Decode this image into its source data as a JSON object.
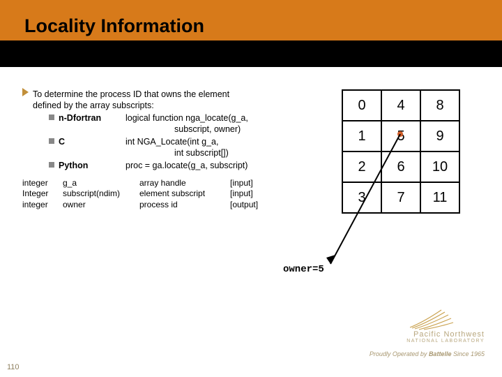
{
  "title": "Locality Information",
  "bullet_main_a": "To determine the process ID that owns the element",
  "bullet_main_b": "defined by the array subscripts:",
  "langs": {
    "fortran": {
      "name": "n-Dfortran",
      "sig_a": "logical function nga_locate(g_a,",
      "sig_b": "subscript, owner)"
    },
    "c": {
      "name": "C",
      "sig_a": "int NGA_Locate(int g_a,",
      "sig_b": "int subscript[])"
    },
    "python": {
      "name": "Python",
      "sig_a": "proc = ga.locate(g_a, subscript)"
    }
  },
  "params": [
    {
      "type": "integer",
      "name": "g_a",
      "desc": "array handle",
      "io": "[input]"
    },
    {
      "type": "Integer",
      "name": "subscript(ndim)",
      "desc": "element subscript",
      "io": "[input]"
    },
    {
      "type": "integer",
      "name": "owner",
      "desc": "process id",
      "io": "[output]"
    }
  ],
  "grid": [
    [
      "0",
      "4",
      "8"
    ],
    [
      "1",
      "5",
      "9"
    ],
    [
      "2",
      "6",
      "10"
    ],
    [
      "3",
      "7",
      "11"
    ]
  ],
  "owner_label": "owner=5",
  "brand": {
    "line1": "Pacific Northwest",
    "line2": "NATIONAL LABORATORY"
  },
  "footer": {
    "prefix": "Proudly Operated by ",
    "bold": "Battelle",
    "suffix": " Since 1965"
  },
  "page_no": "110"
}
